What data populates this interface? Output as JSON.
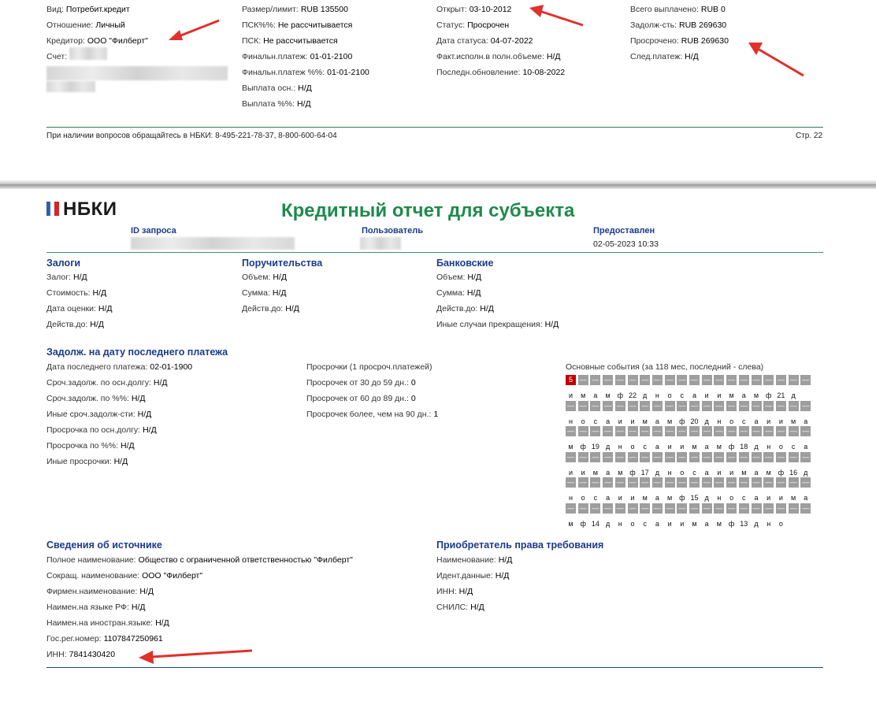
{
  "page1": {
    "col1": [
      {
        "label": "Вид:",
        "value": "Потребит.кредит"
      },
      {
        "label": "Отношение:",
        "value": "Личный"
      },
      {
        "label": "Кредитор:",
        "value": "ООО \"Филберт\""
      },
      {
        "label": "Счет:",
        "value": ""
      }
    ],
    "col2": [
      {
        "label": "Размер/лимит:",
        "value": "RUB 135500"
      },
      {
        "label": "ПСК%%:",
        "value": "Не рассчитывается"
      },
      {
        "label": "ПСК:",
        "value": "Не рассчитывается"
      },
      {
        "label": "Финальн.платеж:",
        "value": "01-01-2100"
      },
      {
        "label": "Финальн.платеж %%:",
        "value": "01-01-2100"
      },
      {
        "label": "Выплата осн.:",
        "value": "Н/Д"
      },
      {
        "label": "Выплата %%:",
        "value": "Н/Д"
      }
    ],
    "col3": [
      {
        "label": "Открыт:",
        "value": "03-10-2012"
      },
      {
        "label": "Статус:",
        "value": "Просрочен"
      },
      {
        "label": "Дата статуса:",
        "value": "04-07-2022"
      },
      {
        "label": "Факт.исполн.в полн.объеме:",
        "value": "Н/Д"
      },
      {
        "label": "Последн.обновление:",
        "value": "10-08-2022"
      }
    ],
    "col4": [
      {
        "label": "Всего выплачено:",
        "value": "RUB 0"
      },
      {
        "label": "Задолж-сть:",
        "value": "RUB 269630"
      },
      {
        "label": "Просрочено:",
        "value": "RUB 269630"
      },
      {
        "label": "След.платеж:",
        "value": "Н/Д"
      }
    ],
    "footer_contact": "При наличии вопросов обращайтесь в НБКИ: 8-495-221-78-37, 8-800-600-64-04",
    "footer_page": "Стр. 22"
  },
  "page2": {
    "logo_text": "НБКИ",
    "title": "Кредитный отчет для субъекта",
    "header": {
      "request_label": "ID запроса",
      "user_label": "Пользователь",
      "provided_label": "Предоставлен",
      "provided_value": "02-05-2023 10:33"
    },
    "collateral": {
      "title": "Залоги",
      "fields": [
        {
          "label": "Залог:",
          "value": "Н/Д"
        },
        {
          "label": "Стоимость:",
          "value": "Н/Д"
        },
        {
          "label": "Дата оценки:",
          "value": "Н/Д"
        },
        {
          "label": "Действ.до:",
          "value": "Н/Д"
        }
      ]
    },
    "guarantees": {
      "title": "Поручительства",
      "fields": [
        {
          "label": "Объем:",
          "value": "Н/Д"
        },
        {
          "label": "Сумма:",
          "value": "Н/Д"
        },
        {
          "label": "Действ.до:",
          "value": "Н/Д"
        }
      ]
    },
    "bank": {
      "title": "Банковские",
      "fields": [
        {
          "label": "Объем:",
          "value": "Н/Д"
        },
        {
          "label": "Сумма:",
          "value": "Н/Д"
        },
        {
          "label": "Действ.до:",
          "value": "Н/Д"
        },
        {
          "label": "Иные случаи прекращения:",
          "value": "Н/Д"
        }
      ]
    },
    "debt": {
      "title": "Задолж. на дату последнего платежа",
      "fields": [
        {
          "label": "Дата последнего платежа:",
          "value": "02-01-1900"
        },
        {
          "label": "Сроч.задолж. по осн.долгу:",
          "value": "Н/Д"
        },
        {
          "label": "Сроч.задолж. по %%:",
          "value": "Н/Д"
        },
        {
          "label": "Иные сроч.задолж-сти:",
          "value": "Н/Д"
        },
        {
          "label": "Просрочка по осн.долгу:",
          "value": "Н/Д"
        },
        {
          "label": "Просрочка по %%:",
          "value": "Н/Д"
        },
        {
          "label": "Иные просрочки:",
          "value": "Н/Д"
        }
      ]
    },
    "delinq": {
      "title": "Просрочки (1 просроч.платежей)",
      "fields": [
        {
          "label": "Просрочек от 30 до 59 дн.:",
          "value": "0"
        },
        {
          "label": "Просрочек от 60 до 89 дн.:",
          "value": "0"
        },
        {
          "label": "Просрочек более, чем на 90 дн.:",
          "value": "1"
        }
      ]
    },
    "events": {
      "title": "Основные события  (за 118 мес, последний - слева)",
      "first_mark": "5",
      "label_rows": [
        [
          "и",
          "м",
          "а",
          "м",
          "ф",
          "22",
          "д",
          "н",
          "о",
          "с",
          "а",
          "и",
          "и",
          "м",
          "а",
          "м",
          "ф",
          "21",
          "д"
        ],
        [
          "н",
          "о",
          "с",
          "а",
          "и",
          "и",
          "м",
          "а",
          "м",
          "ф",
          "20",
          "д",
          "н",
          "о",
          "с",
          "а",
          "и",
          "и",
          "м",
          "а"
        ],
        [
          "м",
          "ф",
          "19",
          "д",
          "н",
          "о",
          "с",
          "а",
          "и",
          "и",
          "м",
          "а",
          "м",
          "ф",
          "18",
          "д",
          "н",
          "о",
          "с",
          "а"
        ],
        [
          "и",
          "и",
          "м",
          "а",
          "м",
          "ф",
          "17",
          "д",
          "н",
          "о",
          "с",
          "а",
          "и",
          "и",
          "м",
          "а",
          "м",
          "ф",
          "16",
          "д"
        ],
        [
          "н",
          "о",
          "с",
          "а",
          "и",
          "и",
          "м",
          "а",
          "м",
          "ф",
          "15",
          "д",
          "н",
          "о",
          "с",
          "а",
          "и",
          "и",
          "м",
          "а"
        ],
        [
          "м",
          "ф",
          "14",
          "д",
          "н",
          "о",
          "с",
          "а",
          "и",
          "и",
          "м",
          "а",
          "м",
          "ф",
          "13",
          "д",
          "н",
          "о"
        ]
      ]
    },
    "source": {
      "title": "Сведения об источнике",
      "fields": [
        {
          "label": "Полное наименование:",
          "value": "Общество с ограниченной ответственностью \"Филберт\""
        },
        {
          "label": "Сокращ. наименование:",
          "value": "ООО \"Филберт\""
        },
        {
          "label": "Фирмен.наименование:",
          "value": "Н/Д"
        },
        {
          "label": "Наимен.на языке РФ:",
          "value": "Н/Д"
        },
        {
          "label": "Наимен.на иностран.языке:",
          "value": "Н/Д"
        },
        {
          "label": "Гос.рег.номер:",
          "value": "1107847250961"
        },
        {
          "label": "ИНН:",
          "value": "7841430420"
        }
      ]
    },
    "assignee": {
      "title": "Приобретатель права требования",
      "fields": [
        {
          "label": "Наименование:",
          "value": "Н/Д"
        },
        {
          "label": "Идент.данные:",
          "value": "Н/Д"
        },
        {
          "label": "ИНН:",
          "value": "Н/Д"
        },
        {
          "label": "СНИЛС:",
          "value": "Н/Д"
        }
      ]
    }
  },
  "colors": {
    "accent_green": "#1e8a4c",
    "heading_blue": "#1b3a8c",
    "arrow_red": "#e0312b",
    "event_gray": "#9e9e9e",
    "event_red": "#c00000"
  }
}
